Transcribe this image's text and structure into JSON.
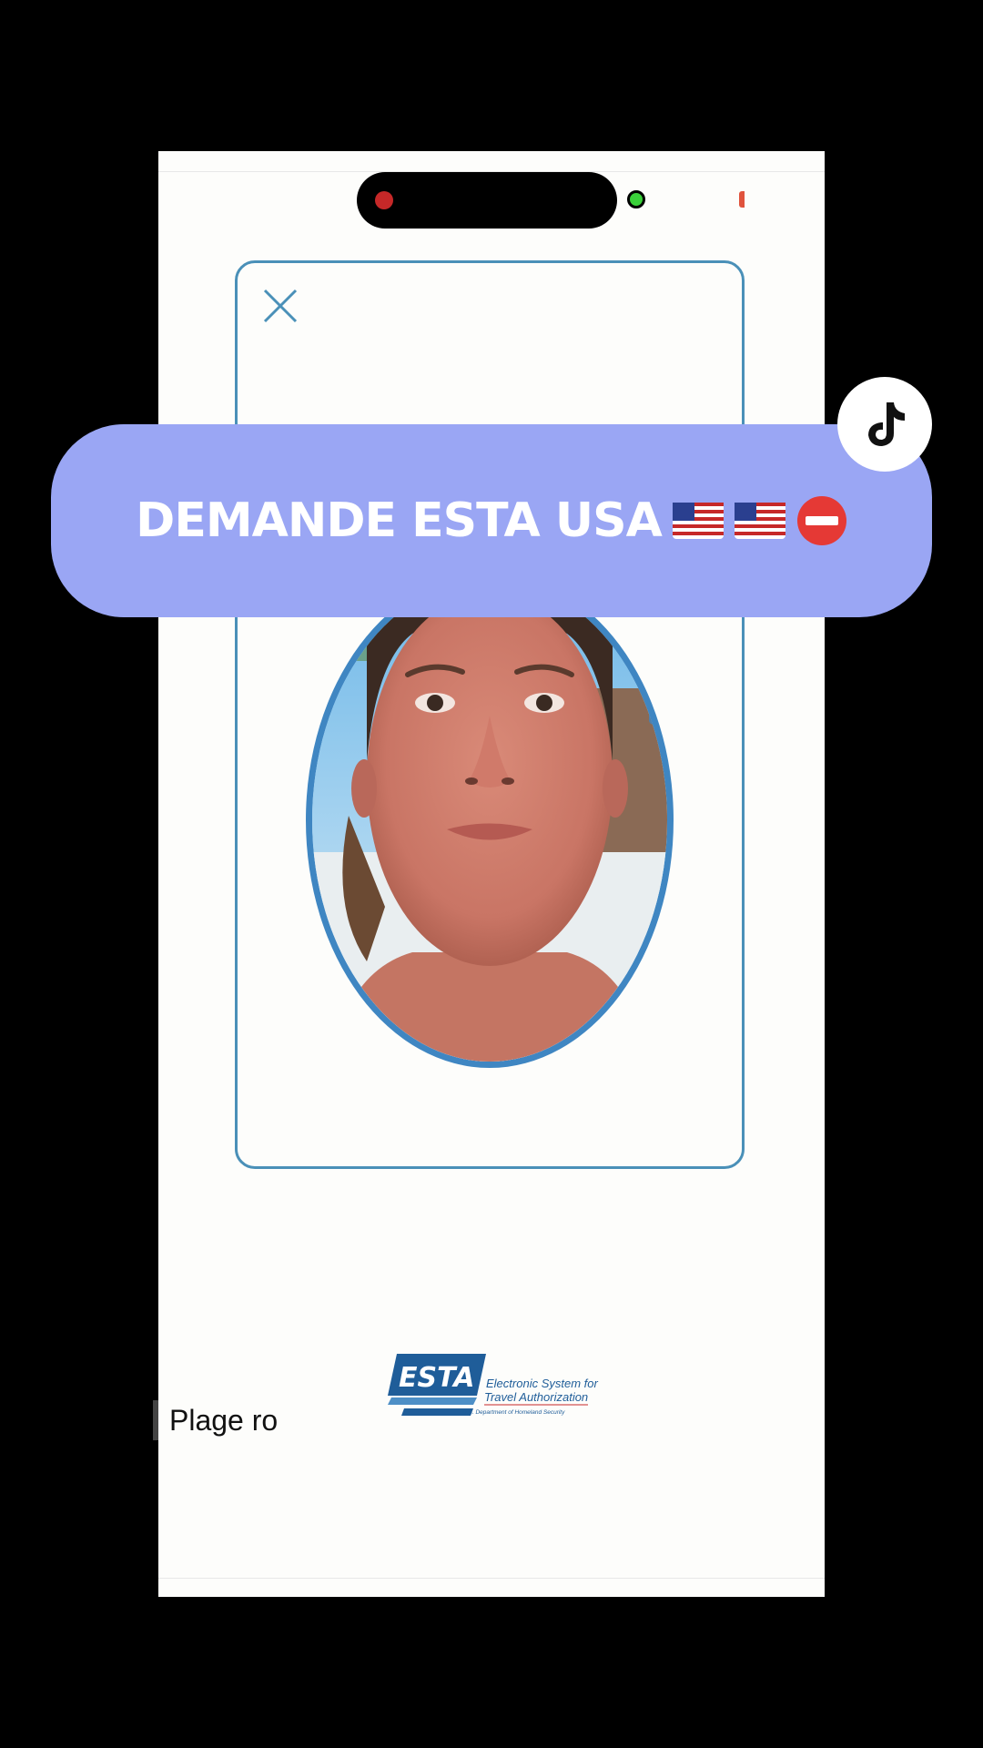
{
  "overlay": {
    "title": "DEMANDE ESTA USA",
    "flags": [
      "us-flag",
      "us-flag",
      "no-entry"
    ]
  },
  "screen": {
    "close_icon": "close-icon",
    "caption": "Plage ro",
    "logo": {
      "mark": "ESTA",
      "line1": "Electronic System for",
      "line2": "Travel Authorization",
      "line3": "U.S. Department of Homeland Security"
    }
  },
  "colors": {
    "banner": "#9aa6f4",
    "frame": "#4a90b8",
    "oval": "#3f86c2",
    "background": "#000000"
  }
}
